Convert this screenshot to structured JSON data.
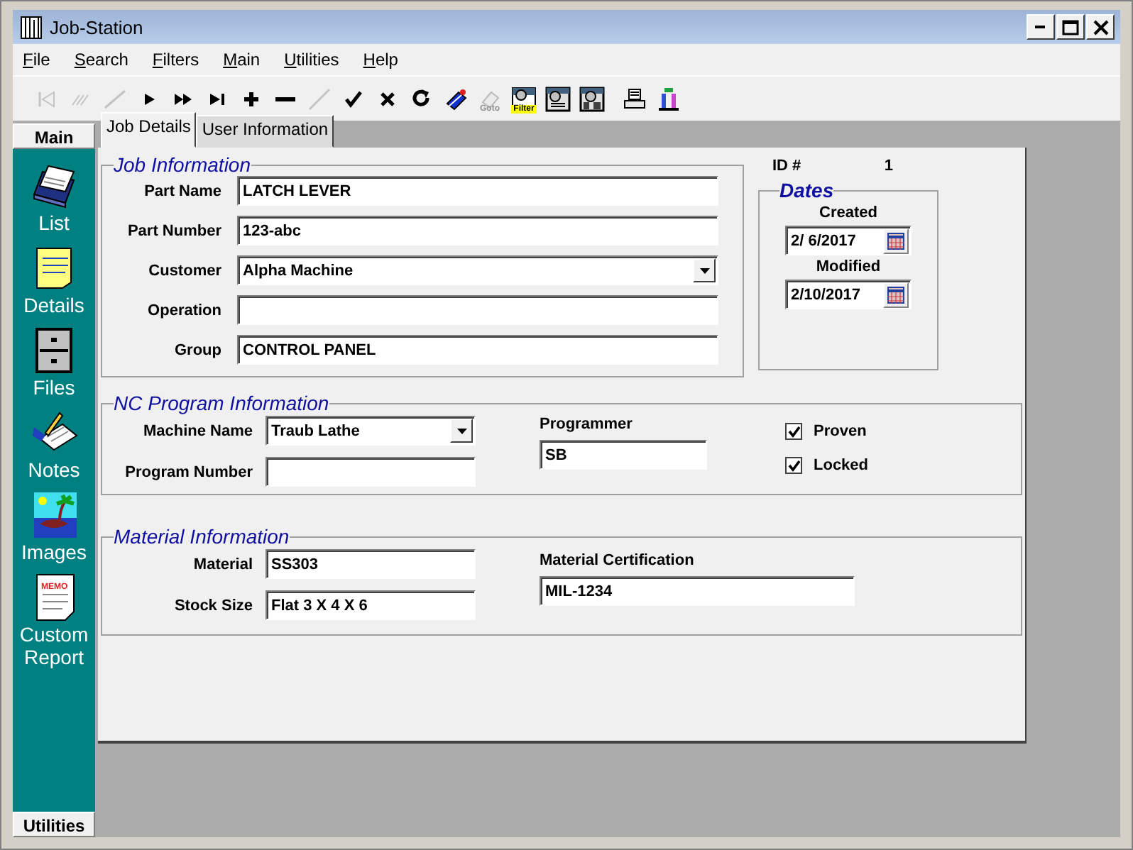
{
  "window": {
    "title": "Job-Station"
  },
  "menu": [
    {
      "label": "File"
    },
    {
      "label": "Search"
    },
    {
      "label": "Filters"
    },
    {
      "label": "Main"
    },
    {
      "label": "Utilities"
    },
    {
      "label": "Help"
    }
  ],
  "toolbar": [
    {
      "kind": "first",
      "disabled": true
    },
    {
      "kind": "prev-page",
      "disabled": true
    },
    {
      "kind": "prev",
      "disabled": true
    },
    {
      "kind": "next",
      "disabled": false
    },
    {
      "kind": "next-page",
      "disabled": false
    },
    {
      "kind": "last",
      "disabled": false
    },
    {
      "kind": "add",
      "disabled": false
    },
    {
      "kind": "remove",
      "disabled": false
    },
    {
      "kind": "edit",
      "disabled": true
    },
    {
      "kind": "save",
      "disabled": false
    },
    {
      "kind": "cancel",
      "disabled": false
    },
    {
      "kind": "refresh",
      "disabled": false
    },
    {
      "kind": "book",
      "disabled": false
    },
    {
      "kind": "goto",
      "label": "Goto",
      "disabled": true
    },
    {
      "kind": "filter",
      "label": "Filter",
      "disabled": false
    },
    {
      "kind": "view",
      "disabled": false
    },
    {
      "kind": "view2",
      "disabled": false
    },
    {
      "kind": "print",
      "disabled": false
    },
    {
      "kind": "chart",
      "disabled": false
    }
  ],
  "sidebar": {
    "header": "Main",
    "footer": "Utilities",
    "items": [
      {
        "label": "List",
        "kind": "cardfile"
      },
      {
        "label": "Details",
        "kind": "notepad"
      },
      {
        "label": "Files",
        "kind": "cabinet"
      },
      {
        "label": "Notes",
        "kind": "writing"
      },
      {
        "label": "Images",
        "kind": "image"
      },
      {
        "label": "Custom Report",
        "kind": "memo",
        "badge": "MEMO"
      }
    ]
  },
  "tabs": [
    {
      "label": "Job Details",
      "selected": true
    },
    {
      "label": "User Information",
      "selected": false
    }
  ],
  "job_information": {
    "title": "Job Information",
    "fields": [
      {
        "label": "Part Name",
        "value": "LATCH LEVER",
        "kind": "text"
      },
      {
        "label": "Part Number",
        "value": "123-abc",
        "kind": "text"
      },
      {
        "label": "Customer",
        "value": "Alpha Machine",
        "kind": "combo"
      },
      {
        "label": "Operation",
        "kind": "text"
      },
      {
        "label": "Group",
        "value": "CONTROL PANEL",
        "kind": "text"
      }
    ]
  },
  "record_id": {
    "label": "ID #",
    "value": "1"
  },
  "dates": {
    "title": "Dates",
    "fields": [
      {
        "label": "Created",
        "value": "2/ 6/2017"
      },
      {
        "label": "Modified",
        "value": "2/10/2017"
      }
    ]
  },
  "nc_program": {
    "title": "NC Program Information",
    "machine_name": {
      "label": "Machine Name",
      "value": "Traub Lathe"
    },
    "program_number": {
      "label": "Program Number"
    },
    "programmer": {
      "label": "Programmer",
      "value": "SB"
    },
    "checks": [
      {
        "label": "Proven",
        "checked": true
      },
      {
        "label": "Locked",
        "checked": true
      }
    ]
  },
  "material": {
    "title": "Material Information",
    "material": {
      "label": "Material",
      "value": "SS303"
    },
    "stock_size": {
      "label": "Stock Size",
      "value": "Flat 3 X 4 X 6"
    },
    "certification": {
      "label": "Material Certification",
      "value": "MIL-1234"
    }
  }
}
